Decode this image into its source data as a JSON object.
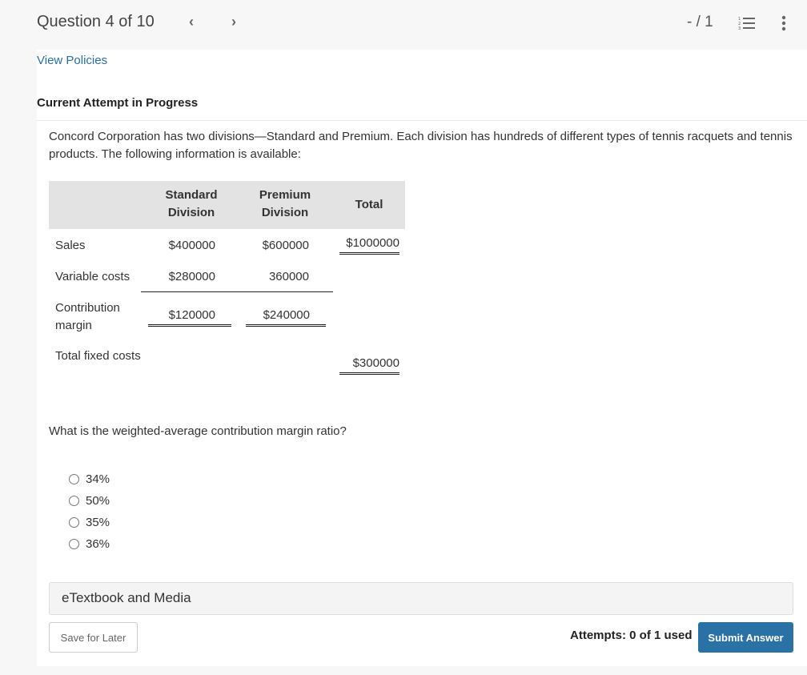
{
  "header": {
    "question_title": "Question 4 of 10",
    "prev_icon": "chevron-left-icon",
    "prev_glyph": "‹",
    "next_icon": "chevron-right-icon",
    "next_glyph": "›",
    "score": "- / 1",
    "list_icon": "numbered-list-icon",
    "more_icon": "more-vertical-icon"
  },
  "links": {
    "view_policies": "View Policies"
  },
  "attempt_heading": "Current Attempt in Progress",
  "intro_text": "Concord Corporation has two divisions—Standard and Premium. Each division has hundreds of different types of tennis racquets and tennis products. The following information is available:",
  "table": {
    "headers": {
      "standard": "Standard Division",
      "premium": "Premium Division",
      "total": "Total"
    },
    "rows": [
      {
        "label": "Sales",
        "standard": "$400000",
        "premium": "$600000",
        "total": "$1000000"
      },
      {
        "label": "Variable costs",
        "standard": "$280000",
        "premium": "360000",
        "total": ""
      },
      {
        "label": "Contribution margin",
        "standard": "$120000",
        "premium": "$240000",
        "total": ""
      },
      {
        "label": "Total fixed costs",
        "standard": "",
        "premium": "",
        "total": "$300000"
      }
    ]
  },
  "question": "What is the weighted-average contribution margin ratio?",
  "options": [
    {
      "label": "34%",
      "selected": false
    },
    {
      "label": "50%",
      "selected": false
    },
    {
      "label": "35%",
      "selected": false
    },
    {
      "label": "36%",
      "selected": false
    }
  ],
  "etextbook_label": "eTextbook and Media",
  "footer": {
    "save_label": "Save for Later",
    "attempts_text": "Attempts: 0 of 1 used",
    "submit_label": "Submit Answer"
  },
  "colors": {
    "link": "#2a6ea6",
    "submit_bg": "#2a72a6",
    "header_bg": "#e3e3e3",
    "page_bg": "#f7f7f7"
  }
}
